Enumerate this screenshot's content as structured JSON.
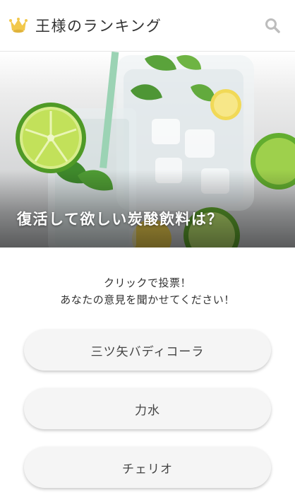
{
  "header": {
    "logo_text": "王様のランキング",
    "crown_color": "#F2C84B",
    "search_icon": "search-icon"
  },
  "hero": {
    "title": "復活して欲しい炭酸飲料は？"
  },
  "prompt": {
    "line1": "クリックで投票！",
    "line2": "あなたの意見を聞かせてください！"
  },
  "choices": [
    {
      "label": "三ツ矢バディコーラ"
    },
    {
      "label": "力水"
    },
    {
      "label": "チェリオ"
    }
  ]
}
